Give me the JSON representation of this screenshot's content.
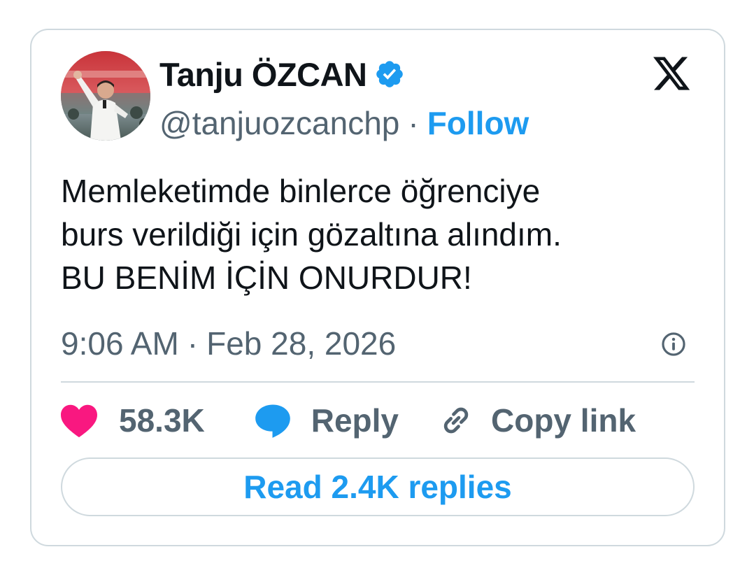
{
  "author": {
    "name": "Tanju ÖZCAN",
    "handle": "@tanjuozcanchp",
    "separator": "·",
    "follow_label": "Follow"
  },
  "tweet": {
    "lines": [
      "Memleketimde binlerce öğrenciye",
      "burs verildiği için gözaltına alındım.",
      "BU BENİM İÇİN ONURDUR!"
    ],
    "time": "9:06 AM",
    "separator": "·",
    "date": "Feb 28, 2026"
  },
  "actions": {
    "likes_count": "58.3K",
    "reply_label": "Reply",
    "copy_link_label": "Copy link"
  },
  "read_replies_label": "Read 2.4K replies",
  "icons": {
    "verified": "verified-badge-icon",
    "logo": "x-logo-icon",
    "info": "info-icon",
    "like": "heart-icon",
    "reply": "speech-bubble-icon",
    "copy": "link-icon"
  },
  "colors": {
    "accent": "#1d9bf0",
    "like": "#f91880",
    "text_primary": "#0f1419",
    "text_secondary": "#536471",
    "border": "#cfd9de"
  }
}
